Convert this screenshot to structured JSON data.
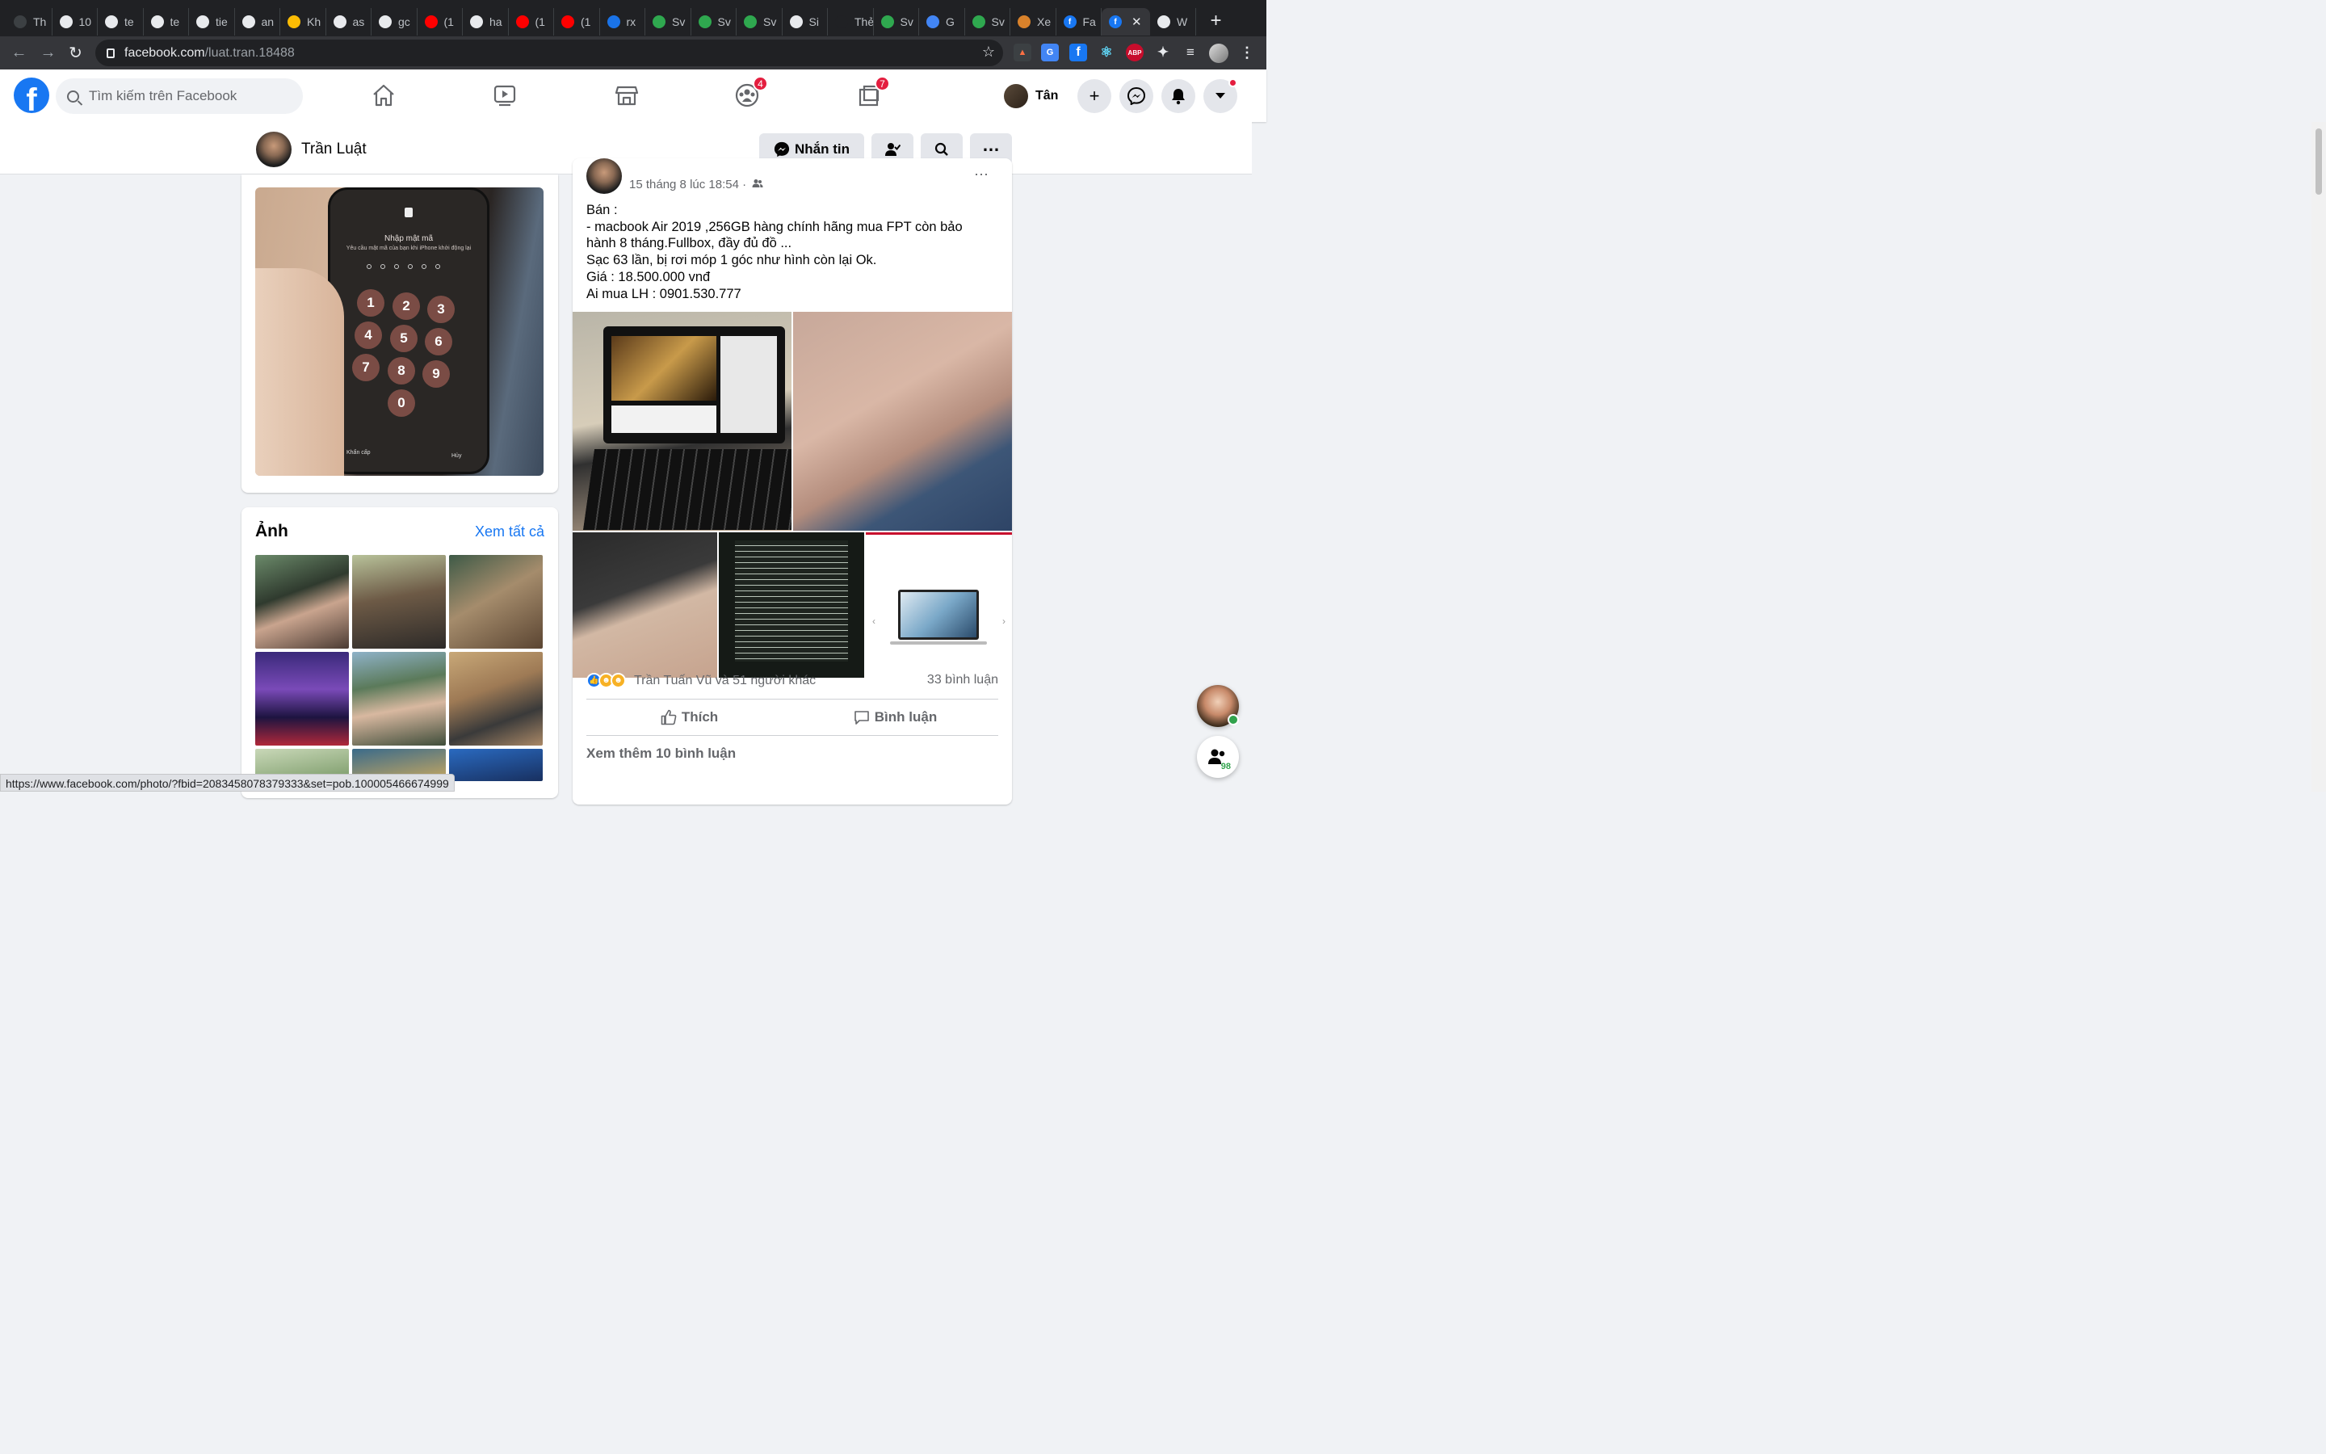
{
  "browser": {
    "tabs": [
      {
        "title": "Th",
        "icon": "pickaxe-icon",
        "color": "#3c4043"
      },
      {
        "title": "10",
        "icon": "github-icon",
        "color": "#e8eaed"
      },
      {
        "title": "te",
        "icon": "github-icon",
        "color": "#e8eaed"
      },
      {
        "title": "te",
        "icon": "github-icon",
        "color": "#e8eaed"
      },
      {
        "title": "tie",
        "icon": "github-icon",
        "color": "#e8eaed"
      },
      {
        "title": "an",
        "icon": "github-icon",
        "color": "#e8eaed"
      },
      {
        "title": "Kh",
        "icon": "google-drive-icon",
        "color": "#fbbc04"
      },
      {
        "title": "as",
        "icon": "github-icon",
        "color": "#e8eaed"
      },
      {
        "title": "gc",
        "icon": "github-icon",
        "color": "#e8eaed"
      },
      {
        "title": "(1",
        "icon": "youtube-icon",
        "color": "#ff0000"
      },
      {
        "title": "ha",
        "icon": "github-icon",
        "color": "#e8eaed"
      },
      {
        "title": "(1",
        "icon": "youtube-icon",
        "color": "#ff0000"
      },
      {
        "title": "(1",
        "icon": "youtube-icon",
        "color": "#ff0000"
      },
      {
        "title": "rx",
        "icon": "bolt-icon",
        "color": "#1a73e8"
      },
      {
        "title": "Sv",
        "icon": "svelte-icon",
        "color": "#2fa84f"
      },
      {
        "title": "Sv",
        "icon": "svelte-icon",
        "color": "#2fa84f"
      },
      {
        "title": "Sv",
        "icon": "svelte-icon",
        "color": "#2fa84f"
      },
      {
        "title": "Si",
        "icon": "github-icon",
        "color": "#e8eaed"
      },
      {
        "title": "Thẻ m",
        "icon": "blank-icon",
        "color": "#202124"
      },
      {
        "title": "Sv",
        "icon": "svelte-icon",
        "color": "#2fa84f"
      },
      {
        "title": "G",
        "icon": "translate-icon",
        "color": "#4285f4"
      },
      {
        "title": "Sv",
        "icon": "svelte-icon",
        "color": "#2fa84f"
      },
      {
        "title": "Xe",
        "icon": "vue-icon",
        "color": "#d9822b"
      },
      {
        "title": "Fa",
        "icon": "facebook-icon",
        "color": "#1877f2"
      },
      {
        "title": "",
        "icon": "facebook-icon",
        "color": "#1877f2",
        "active": true
      },
      {
        "title": "W",
        "icon": "chat-icon",
        "color": "#e8eaed"
      }
    ],
    "url_host": "facebook.com",
    "url_path": "/luat.tran.18488",
    "status_url": "https://www.facebook.com/photo/?fbid=2083458078379333&set=pob.100005466674999"
  },
  "fb": {
    "search_placeholder": "Tìm kiếm trên Facebook",
    "groups_badge": "4",
    "gaming_badge": "7",
    "user_name": "Tân",
    "profile_name": "Trần Luật",
    "message_button": "Nhắn tin",
    "photos_title": "Ảnh",
    "see_all": "Xem tất cả",
    "post": {
      "timestamp": "15 tháng 8 lúc 18:54 ·",
      "text": "Bán :\n- macbook Air 2019 ,256GB hàng chính hãng mua FPT còn bảo hành 8 tháng.Fullbox, đầy đủ đồ ...\nSạc 63 lần, bị rơi móp 1 góc như hình còn lại Ok.\nGiá : 18.500.000 vnđ\nAi mua LH : 0901.530.777",
      "reactions_text": "Trần Tuấn Vũ và 51 người khác",
      "comments_count": "33 bình luận",
      "like_label": "Thích",
      "comment_label": "Bình luận",
      "more_comments": "Xem thêm 10 bình luận"
    },
    "phone_lock": {
      "title": "Nhập mật mã",
      "subtitle": "Yêu cầu mật mã của bạn khi iPhone khởi động lại",
      "keys": [
        "1",
        "2",
        "3",
        "4",
        "5",
        "6",
        "7",
        "8",
        "9",
        "0"
      ],
      "emergency": "Khẩn cấp",
      "cancel": "Hủy"
    },
    "contacts_badge": "98"
  },
  "colors": {
    "fb_blue": "#1877f2",
    "badge_red": "#e41e3f",
    "chrome_dark": "#202124"
  }
}
